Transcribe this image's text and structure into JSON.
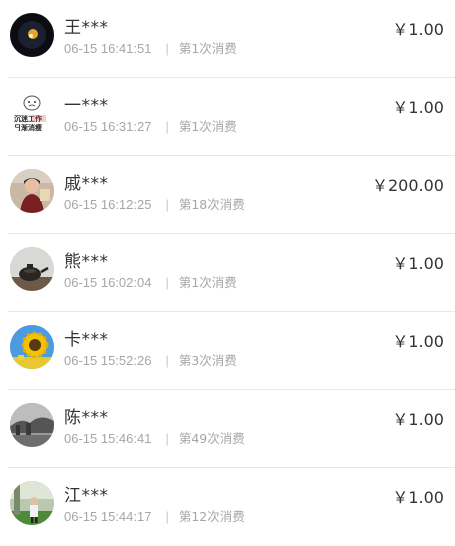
{
  "records": [
    {
      "name": "王***",
      "time": "06-15 16:41:51",
      "count": "第1次消费",
      "amount": "￥1.00",
      "avatar": "dark-night-avatar"
    },
    {
      "name": "一***",
      "time": "06-15 16:31:27",
      "count": "第1次消费",
      "amount": "￥1.00",
      "avatar": "cartoon-text-avatar",
      "avatar_text_1": "沉迷工作",
      "avatar_text_2": "日渐消瘦"
    },
    {
      "name": "戚***",
      "time": "06-15 16:12:25",
      "count": "第18次消费",
      "amount": "￥200.00",
      "avatar": "person-photo-avatar"
    },
    {
      "name": "熊***",
      "time": "06-15 16:02:04",
      "count": "第1次消费",
      "amount": "￥1.00",
      "avatar": "teapot-avatar"
    },
    {
      "name": "卡***",
      "time": "06-15 15:52:26",
      "count": "第3次消费",
      "amount": "￥1.00",
      "avatar": "sunflower-avatar"
    },
    {
      "name": "陈***",
      "time": "06-15 15:46:41",
      "count": "第49次消费",
      "amount": "￥1.00",
      "avatar": "gray-landscape-avatar"
    },
    {
      "name": "江***",
      "time": "06-15 15:44:17",
      "count": "第12次消费",
      "amount": "￥1.00",
      "avatar": "outdoor-person-avatar"
    }
  ]
}
